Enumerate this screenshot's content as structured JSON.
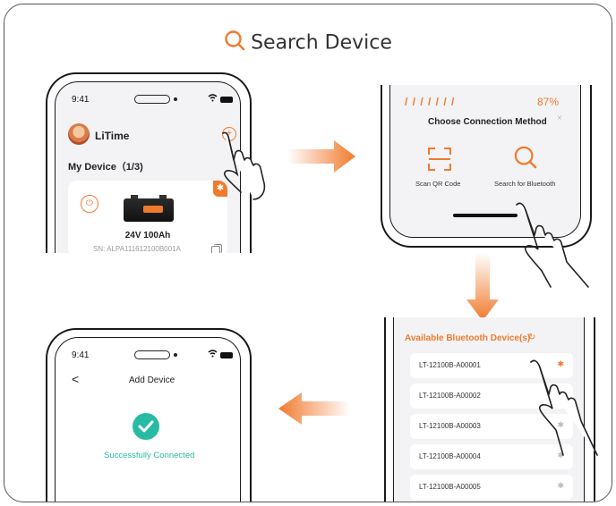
{
  "header": {
    "title": "Search Device",
    "icon": "search-icon"
  },
  "colors": {
    "accent": "#f07a2d",
    "success": "#27bba4"
  },
  "phone1": {
    "time": "9:41",
    "app_name": "LiTime",
    "my_device": "My Device（1/3)",
    "device": {
      "name": "24V 100Ah",
      "sn": "SN: ALPA111612100B001A"
    }
  },
  "phone2": {
    "progress_pct": "87%",
    "sheet_title": "Choose Connection Method",
    "close": "×",
    "options": [
      {
        "label": "Scan QR Code",
        "icon": "qr-scan-icon"
      },
      {
        "label": "Search for Bluetooth",
        "icon": "search-icon"
      }
    ]
  },
  "phone3": {
    "title": "Available Bluetooth Device(s)",
    "refresh_icon": "refresh-icon",
    "devices": [
      {
        "label": "LT-12100B-A00001",
        "active": true
      },
      {
        "label": "LT-12100B-A00002",
        "active": false
      },
      {
        "label": "LT-12100B-A00003",
        "active": false
      },
      {
        "label": "LT-12100B-A00004",
        "active": false
      },
      {
        "label": "LT-12100B-A00005",
        "active": false
      }
    ]
  },
  "phone4": {
    "time": "9:41",
    "back": "<",
    "title": "Add Device",
    "status": "Successfully Connected"
  }
}
